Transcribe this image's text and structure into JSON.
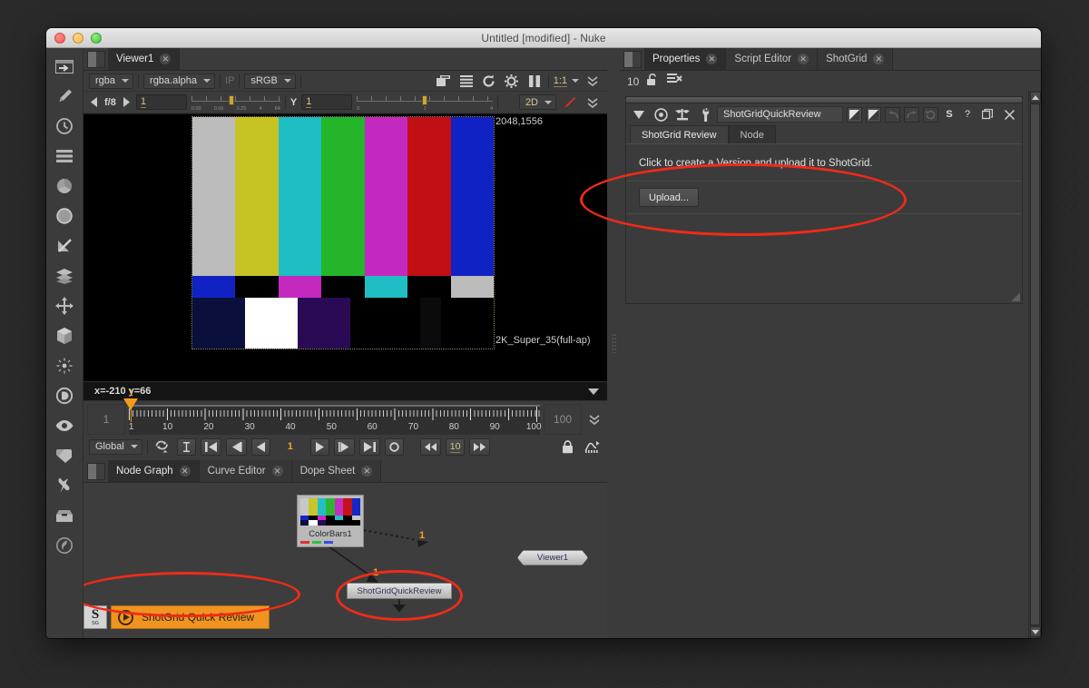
{
  "window": {
    "title": "Untitled [modified] - Nuke",
    "traffic_lights": [
      "close",
      "minimize",
      "zoom"
    ]
  },
  "left_toolbar": {
    "items": [
      {
        "name": "node-toolbar-image-icon",
        "label": "Image"
      },
      {
        "name": "node-toolbar-draw-icon",
        "label": "Draw"
      },
      {
        "name": "node-toolbar-time-icon",
        "label": "Time"
      },
      {
        "name": "node-toolbar-channel-icon",
        "label": "Channel"
      },
      {
        "name": "node-toolbar-color-icon",
        "label": "Color"
      },
      {
        "name": "node-toolbar-filter-icon",
        "label": "Filter"
      },
      {
        "name": "node-toolbar-keyer-icon",
        "label": "Keyer"
      },
      {
        "name": "node-toolbar-merge-icon",
        "label": "Merge"
      },
      {
        "name": "node-toolbar-transform-icon",
        "label": "Transform"
      },
      {
        "name": "node-toolbar-3d-icon",
        "label": "3D"
      },
      {
        "name": "node-toolbar-particles-icon",
        "label": "Particles"
      },
      {
        "name": "node-toolbar-deep-icon",
        "label": "Deep"
      },
      {
        "name": "node-toolbar-views-icon",
        "label": "Views"
      },
      {
        "name": "node-toolbar-metadata-icon",
        "label": "Metadata"
      },
      {
        "name": "node-toolbar-other-icon",
        "label": "Other"
      },
      {
        "name": "node-toolbar-toolsets-icon",
        "label": "ToolSets"
      },
      {
        "name": "node-toolbar-plugin-icon",
        "label": "Plugins"
      }
    ]
  },
  "viewer_panel": {
    "tabs": [
      {
        "label": "Viewer1",
        "active": true,
        "closable": true
      }
    ],
    "toolbar": {
      "channel_set": "rgba",
      "channel": "rgba.alpha",
      "ip_label": "IP",
      "colorspace": "sRGB",
      "zoom": "1:1",
      "icons": [
        "layout-icon",
        "list-icon",
        "refresh-icon",
        "roi-icon",
        "pause-icon"
      ]
    },
    "toolbar2": {
      "exposure_label": "f/8",
      "exposure_value": "1",
      "gamma_label": "Y",
      "gamma_value": "1",
      "exposure_slider_ticks": [
        "0.00",
        "0.06",
        "0.25",
        "1",
        "4",
        "64"
      ],
      "gamma_slider_ticks": [
        "0",
        "1",
        "4"
      ],
      "view_mode": "2D"
    },
    "overlay": {
      "resolution_top": "2048,1556",
      "format_bottom": "2K_Super_35(full-ap)"
    },
    "status": "x=-210 y=66",
    "color_bars": {
      "top_row": [
        "#bcbcbc",
        "#c6c425",
        "#1fbdc4",
        "#24b52b",
        "#c429bf",
        "#c20f14",
        "#1122c4"
      ],
      "mid_row": [
        "#1122c4",
        "#000000",
        "#c429bf",
        "#000000",
        "#1fbdc4",
        "#000000",
        "#bcbcbc"
      ],
      "bottom_segments": [
        "#0a0f3c",
        "#ffffff",
        "#2a0a55",
        "#000000",
        "#000000",
        "#050505",
        "#000000"
      ]
    }
  },
  "timeline": {
    "start_frame": "1",
    "end_frame": "100",
    "current_frame": "1",
    "playhead_frame": "1",
    "tick_labels": [
      "1",
      "10",
      "20",
      "30",
      "40",
      "50",
      "60",
      "70",
      "80",
      "90",
      "100"
    ],
    "range_selector": "Global",
    "increment": "10",
    "controls": [
      {
        "name": "playback-mode-button",
        "label": "loop"
      },
      {
        "name": "set-in-point-button",
        "label": "I"
      },
      {
        "name": "first-frame-button",
        "label": "first"
      },
      {
        "name": "previous-keyframe-button",
        "label": "prev-key"
      },
      {
        "name": "step-back-button",
        "label": "back"
      },
      {
        "name": "play-forward-button",
        "label": "play"
      },
      {
        "name": "step-forward-button",
        "label": "forward"
      },
      {
        "name": "last-frame-button",
        "label": "last"
      },
      {
        "name": "set-out-point-button",
        "label": "O"
      }
    ]
  },
  "nodegraph_panel": {
    "tabs": [
      {
        "label": "Node Graph",
        "active": true,
        "closable": true
      },
      {
        "label": "Curve Editor",
        "active": false,
        "closable": true
      },
      {
        "label": "Dope Sheet",
        "active": false,
        "closable": true
      }
    ],
    "nodes": [
      {
        "name": "ColorBars1",
        "type": "thumbnail"
      },
      {
        "name": "Viewer1",
        "type": "viewer"
      },
      {
        "name": "ShotGridQuickReview",
        "type": "pill"
      }
    ],
    "connection_labels": [
      "1",
      "1"
    ]
  },
  "shotgrid_bar": {
    "logo_letter": "S",
    "logo_sub": "SG",
    "button_label": "ShotGrid Quick Review",
    "accent_color": "#f0941f"
  },
  "properties_panel": {
    "tabs": [
      {
        "label": "Properties",
        "active": true,
        "closable": true
      },
      {
        "label": "Script Editor",
        "active": false,
        "closable": true
      },
      {
        "label": "ShotGrid",
        "active": false,
        "closable": true
      }
    ],
    "max_panels": "10",
    "toolrow_icons": [
      "unlock-icon",
      "clear-all-icon"
    ],
    "node": {
      "name": "ShotGridQuickReview",
      "header_icons": [
        "collapse-icon",
        "color-icon",
        "mask-icon",
        "wrench-icon"
      ],
      "right_buttons": [
        "load-icon",
        "save-icon",
        "undo-icon",
        "redo-icon",
        "revert-icon",
        "S",
        "?",
        "float-icon",
        "close-icon"
      ],
      "tabs": [
        {
          "label": "ShotGrid Review",
          "active": true
        },
        {
          "label": "Node",
          "active": false
        }
      ],
      "message": "Click to create a Version and upload it to ShotGrid.",
      "upload_button": "Upload..."
    }
  },
  "annotations": {
    "color": "#ef2b19",
    "ellipses": [
      "properties-upload-area",
      "shotgrid-quick-review-button",
      "shotgridquickreview-node"
    ]
  }
}
